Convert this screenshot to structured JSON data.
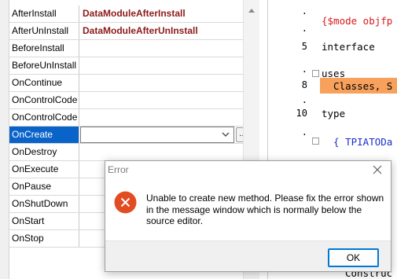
{
  "inspector": {
    "rows": [
      {
        "name": "AfterInstall",
        "value": "DataModuleAfterInstall"
      },
      {
        "name": "AfterUnInstall",
        "value": "DataModuleAfterUnInstall"
      },
      {
        "name": "BeforeInstall",
        "value": ""
      },
      {
        "name": "BeforeUnInstall",
        "value": ""
      },
      {
        "name": "OnContinue",
        "value": ""
      },
      {
        "name": "OnControlCode",
        "value": ""
      },
      {
        "name": "OnControlCode",
        "value": ""
      },
      {
        "name": "OnCreate",
        "value": ""
      },
      {
        "name": "OnDestroy",
        "value": ""
      },
      {
        "name": "OnExecute",
        "value": ""
      },
      {
        "name": "OnPause",
        "value": ""
      },
      {
        "name": "OnShutDown",
        "value": ""
      },
      {
        "name": "OnStart",
        "value": ""
      },
      {
        "name": "OnStop",
        "value": ""
      }
    ],
    "selected_row": "OnCreate",
    "ellipsis_label": "...",
    "selection_color": "#0a63c9",
    "value_color": "#8b1a1a"
  },
  "editor": {
    "lines": [
      {
        "num": "",
        "code": "{$mode objfp"
      },
      {
        "num": "5",
        "code": "interface"
      },
      {
        "num": "",
        "code": "uses"
      },
      {
        "num": "8",
        "code": "  Classes, S"
      },
      {
        "num": "10",
        "code": "type"
      },
      {
        "num": "",
        "code": "  { TPIATODa"
      },
      {
        "num": "",
        "code": "Construc"
      }
    ],
    "highlight_color": "#f7a15c",
    "directive_color": "#d81b1b",
    "comment_color": "#1a2fc9"
  },
  "dialog": {
    "title": "Error",
    "message": "Unable to create new method. Please fix the error shown in the message window which is normally below the source editor.",
    "ok_label": "OK",
    "icon": "error-icon",
    "icon_color": "#e24c23"
  }
}
